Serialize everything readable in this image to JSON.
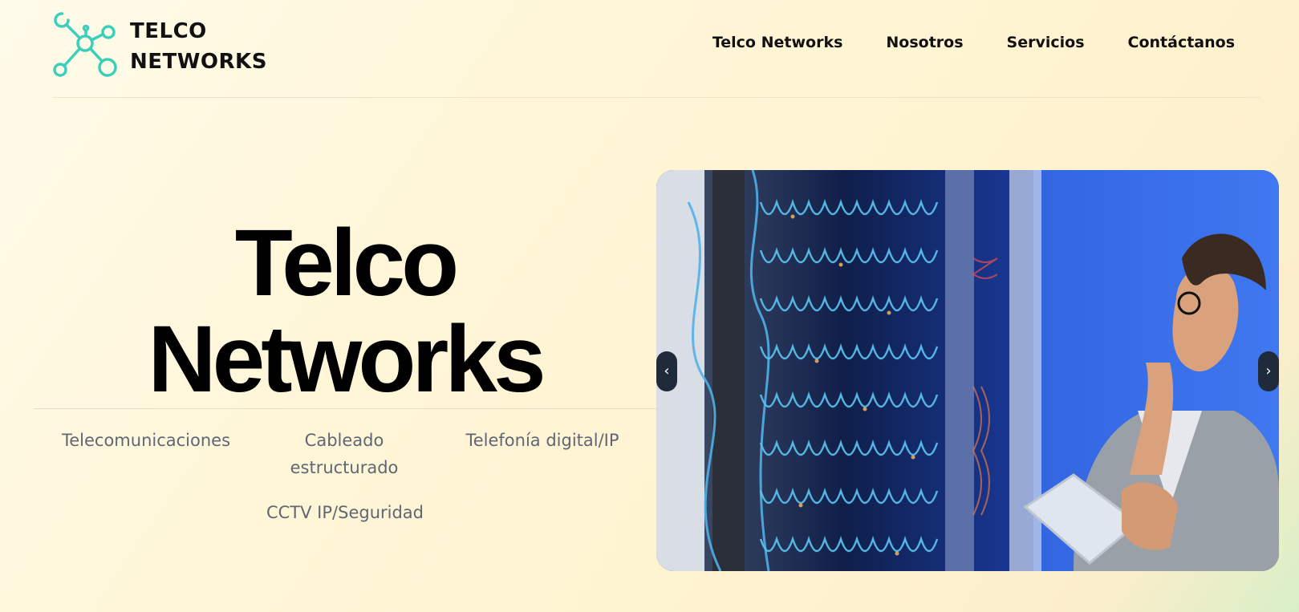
{
  "brand": {
    "logo_icon": "network-nodes-icon",
    "logo_line1": "TELCO",
    "logo_line2": "NETWORKS",
    "accent_color": "#3ccfbb"
  },
  "nav": {
    "items": [
      {
        "label": "Telco Networks"
      },
      {
        "label": "Nosotros"
      },
      {
        "label": "Servicios"
      },
      {
        "label": "Contáctanos"
      }
    ]
  },
  "hero": {
    "title_line1": "Telco",
    "title_line2": "Networks",
    "services": [
      {
        "label": "Telecomunicaciones"
      },
      {
        "label": "Cableado estructurado"
      },
      {
        "label": "Telefonía digital/IP"
      },
      {
        "label": "CCTV IP/Seguridad"
      }
    ]
  },
  "carousel": {
    "prev_icon": "chevron-left-icon",
    "next_icon": "chevron-right-icon",
    "prev_glyph": "‹",
    "next_glyph": "›"
  }
}
